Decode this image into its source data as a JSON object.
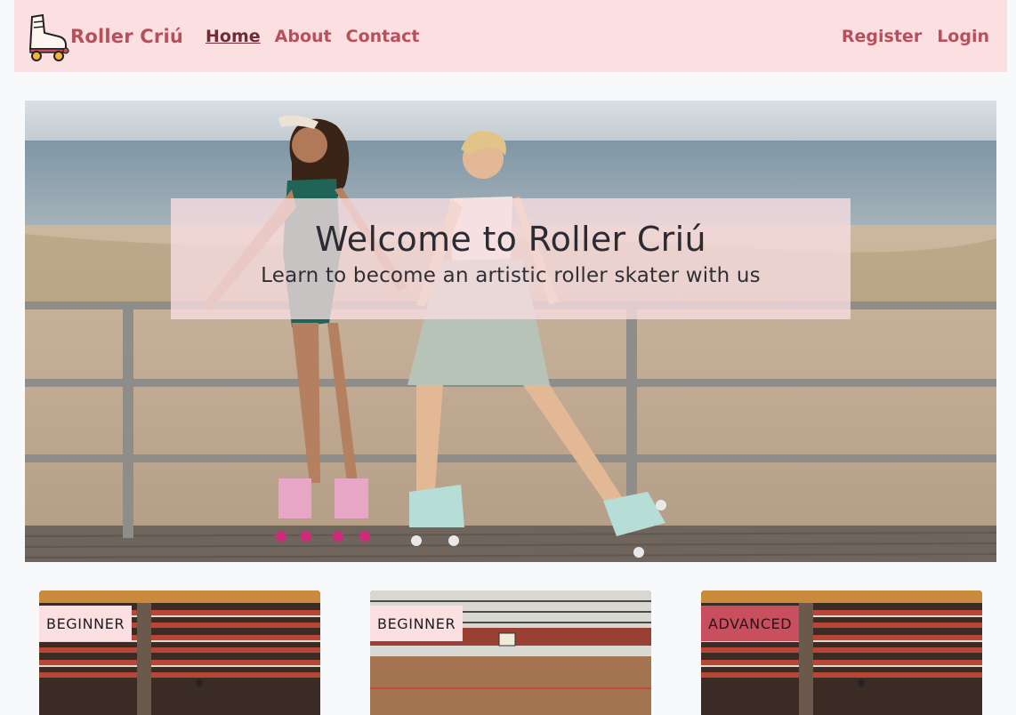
{
  "nav": {
    "brand": "Roller Criú",
    "links": [
      "Home",
      "About",
      "Contact"
    ],
    "right_links": [
      "Register",
      "Login"
    ],
    "active": "Home",
    "logo_icon": "roller-skate-icon"
  },
  "hero": {
    "title": "Welcome to Roller Criú",
    "subtitle": "Learn to become an artistic roller skater with us"
  },
  "cards": [
    {
      "badge": "BEGINNER",
      "image": "stadium-stands"
    },
    {
      "badge": "BEGINNER",
      "image": "sports-hall"
    },
    {
      "badge": "ADVANCED",
      "image": "stadium-stands"
    }
  ],
  "colors": {
    "nav_bg": "#fbdfe1",
    "brand": "#b8505c",
    "active_link": "#6e2d35",
    "advanced_badge": "#c84f5e"
  }
}
